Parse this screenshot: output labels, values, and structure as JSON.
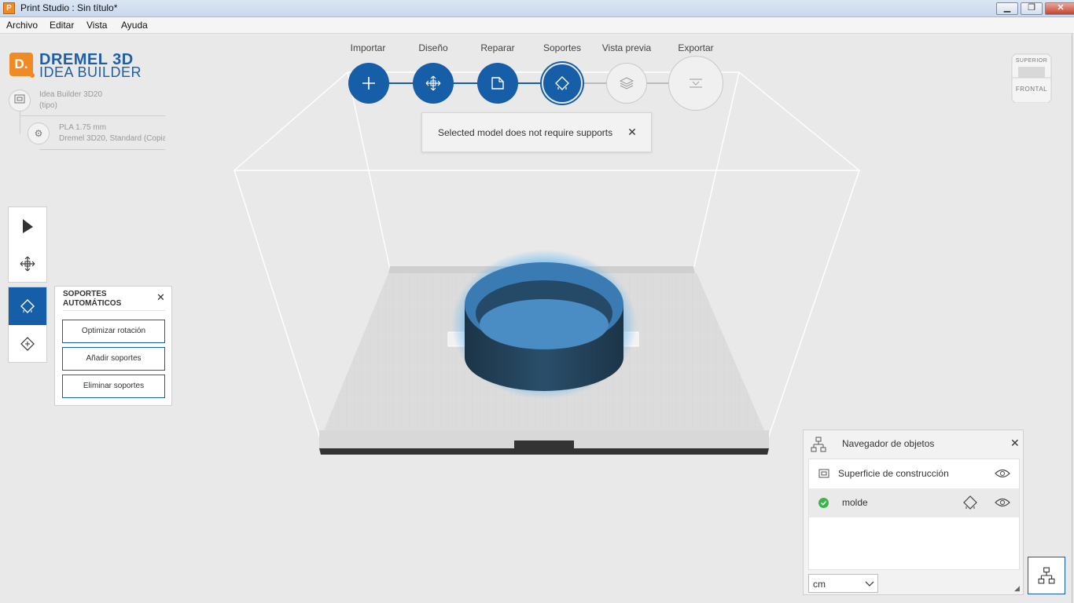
{
  "window": {
    "title": "Print Studio : Sin título*",
    "app_icon": "P",
    "buttons": {
      "minimize": "▁",
      "restore": "❐",
      "close": "✕"
    }
  },
  "menu": [
    "Archivo",
    "Editar",
    "Vista",
    "Ayuda"
  ],
  "logo": {
    "line1": "DREMEL 3D",
    "line2": "IDEA BUILDER",
    "mark": "D."
  },
  "printer": {
    "name": "Idea Builder 3D20",
    "type": "(tipo)",
    "icon": "printer-icon"
  },
  "material": {
    "name": "PLA 1.75 mm",
    "profile": "Dremel 3D20, Standard (Copia",
    "icon": "gear-icon"
  },
  "workflow": {
    "steps": [
      {
        "label": "Importar",
        "icon": "plus-icon",
        "state": "done"
      },
      {
        "label": "Diseño",
        "icon": "move-icon",
        "state": "done"
      },
      {
        "label": "Reparar",
        "icon": "repair-icon",
        "state": "done"
      },
      {
        "label": "Soportes",
        "icon": "supports-icon",
        "state": "current"
      },
      {
        "label": "Vista previa",
        "icon": "layers-icon",
        "state": "inactive"
      },
      {
        "label": "Exportar",
        "icon": "export-icon",
        "state": "inactive"
      }
    ]
  },
  "toast": {
    "message": "Selected model does not require supports",
    "close": "✕"
  },
  "viewcube": {
    "top": "SUPERIOR",
    "front": "FRONTAL"
  },
  "supports_panel": {
    "title": "SOPORTES AUTOMÁTICOS",
    "close": "✕",
    "buttons": [
      "Optimizar rotación",
      "Añadir soportes",
      "Eliminar soportes"
    ]
  },
  "object_navigator": {
    "title": "Navegador de objetos",
    "close": "✕",
    "items": [
      {
        "label": "Superficie de construcción",
        "status": "",
        "selected": false
      },
      {
        "label": "molde",
        "status": "ok",
        "selected": true
      }
    ],
    "unit": "cm",
    "grip": "◢"
  },
  "colors": {
    "accent": "#165ea8",
    "brand_orange": "#f08a24",
    "model": "#3b7bb3",
    "ok_green": "#3cb44b"
  }
}
